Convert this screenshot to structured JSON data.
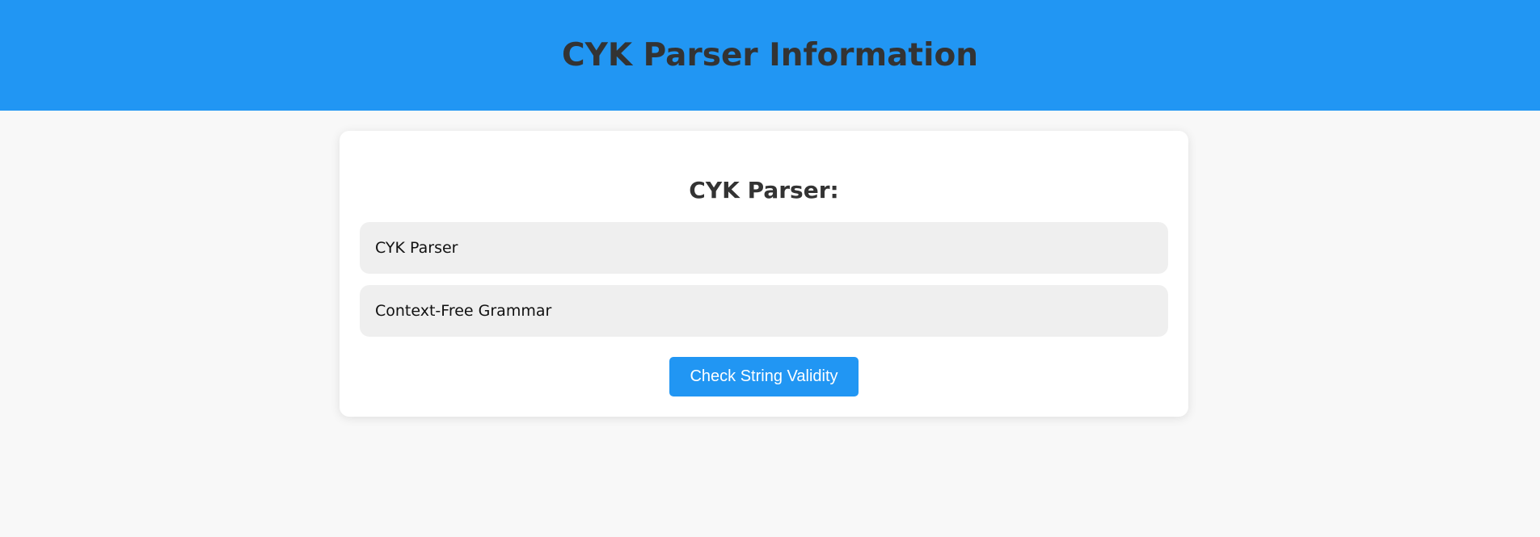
{
  "header": {
    "title": "CYK Parser Information"
  },
  "card": {
    "heading": "CYK Parser:",
    "items": [
      {
        "label": "CYK Parser"
      },
      {
        "label": "Context-Free Grammar"
      }
    ],
    "button_label": "Check String Validity"
  },
  "colors": {
    "accent": "#2196f3",
    "page_background": "#f8f8f8",
    "card_background": "#ffffff",
    "item_background": "#efefef",
    "text": "#333333"
  }
}
